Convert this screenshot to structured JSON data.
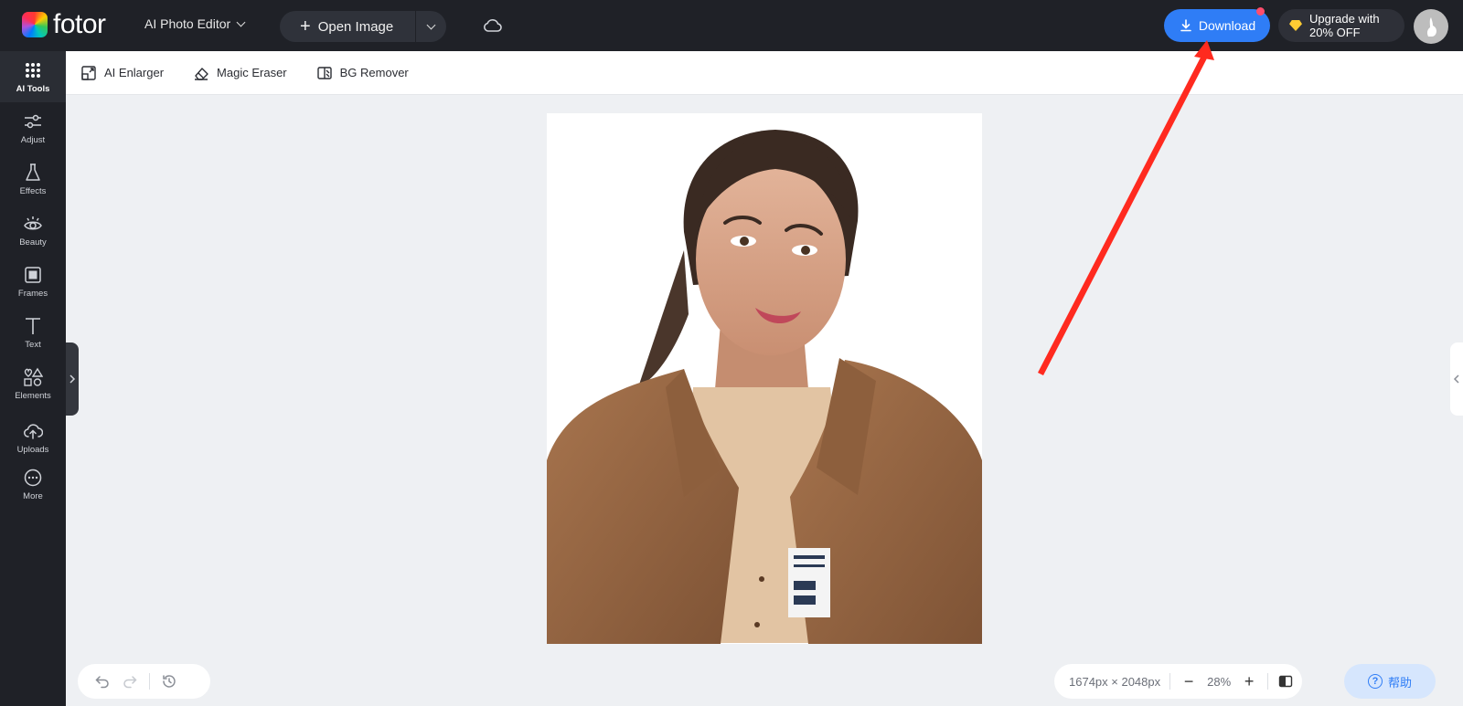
{
  "brand": {
    "name": "fotor"
  },
  "header": {
    "editor_label": "AI Photo Editor",
    "open_image_label": "Open Image",
    "download_label": "Download",
    "upgrade_line1": "Upgrade with",
    "upgrade_line2": "20% OFF"
  },
  "sidebar": {
    "items": [
      {
        "label": "AI Tools",
        "icon": "grid-dots-icon"
      },
      {
        "label": "Adjust",
        "icon": "sliders-icon"
      },
      {
        "label": "Effects",
        "icon": "flask-icon"
      },
      {
        "label": "Beauty",
        "icon": "eye-icon"
      },
      {
        "label": "Frames",
        "icon": "frame-icon"
      },
      {
        "label": "Text",
        "icon": "text-icon"
      },
      {
        "label": "Elements",
        "icon": "shapes-icon"
      },
      {
        "label": "Uploads",
        "icon": "cloud-upload-icon"
      },
      {
        "label": "More",
        "icon": "more-icon"
      }
    ]
  },
  "toolbar": {
    "tools": [
      {
        "label": "AI Enlarger",
        "icon": "enlarge-icon"
      },
      {
        "label": "Magic Eraser",
        "icon": "eraser-icon"
      },
      {
        "label": "BG Remover",
        "icon": "bg-remove-icon"
      }
    ]
  },
  "status": {
    "dimensions": "1674px × 2048px",
    "zoom": "28%",
    "help_label": "帮助"
  },
  "colors": {
    "accent": "#2f7df6",
    "dark_bg": "#1f2127",
    "annotation_arrow": "#ff2a1f"
  }
}
